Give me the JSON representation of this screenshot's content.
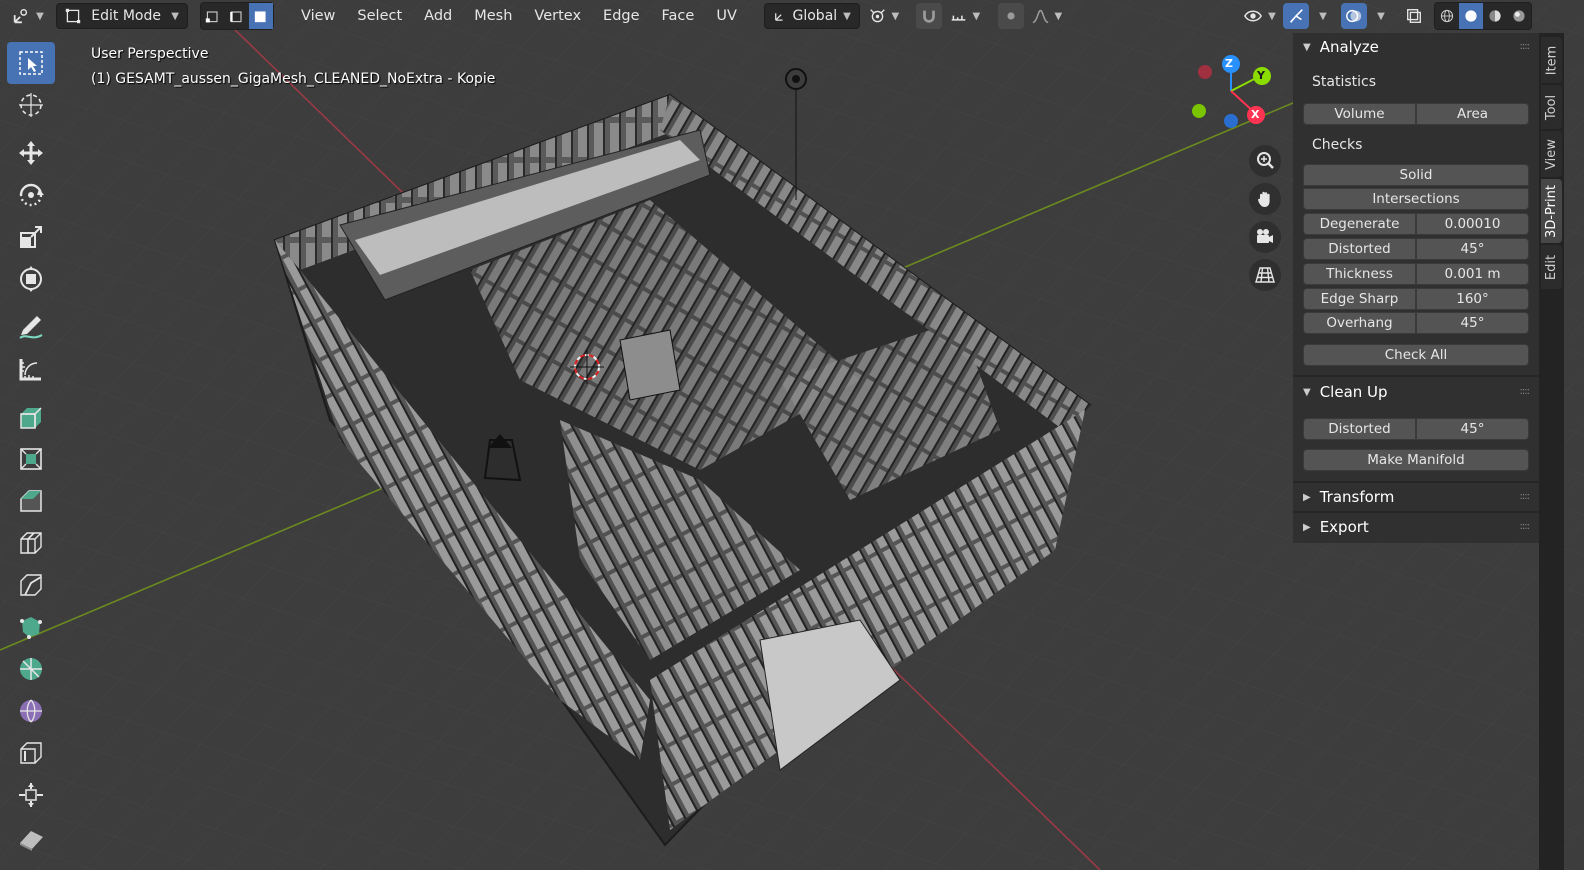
{
  "header": {
    "mode": "Edit Mode",
    "menus": [
      "View",
      "Select",
      "Add",
      "Mesh",
      "Vertex",
      "Edge",
      "Face",
      "UV"
    ],
    "transform_orientation": "Global"
  },
  "viewport": {
    "perspective_label": "User Perspective",
    "object_label": "(1) GESAMT_aussen_GigaMesh_CLEANED_NoExtra - Kopie",
    "gizmo_axes": {
      "x": "X",
      "y": "Y",
      "z": "Z"
    }
  },
  "npanel": {
    "analyze": {
      "title": "Analyze",
      "statistics_label": "Statistics",
      "volume": "Volume",
      "area": "Area",
      "checks_label": "Checks",
      "solid": "Solid",
      "intersections": "Intersections",
      "degenerate_label": "Degenerate",
      "degenerate_value": "0.00010",
      "distorted_label": "Distorted",
      "distorted_value": "45°",
      "thickness_label": "Thickness",
      "thickness_value": "0.001 m",
      "edge_sharp_label": "Edge Sharp",
      "edge_sharp_value": "160°",
      "overhang_label": "Overhang",
      "overhang_value": "45°",
      "check_all": "Check All"
    },
    "cleanup": {
      "title": "Clean Up",
      "distorted_label": "Distorted",
      "distorted_value": "45°",
      "make_manifold": "Make Manifold"
    },
    "transform": {
      "title": "Transform"
    },
    "export": {
      "title": "Export"
    }
  },
  "tabs": [
    "Item",
    "Tool",
    "View",
    "3D-Print",
    "Edit"
  ],
  "colors": {
    "accent": "#4772b3",
    "axis_x": "#ff3352",
    "axis_y": "#8bdc00",
    "axis_z": "#2890ff",
    "background": "#3d3d3d",
    "panel": "#303030"
  }
}
